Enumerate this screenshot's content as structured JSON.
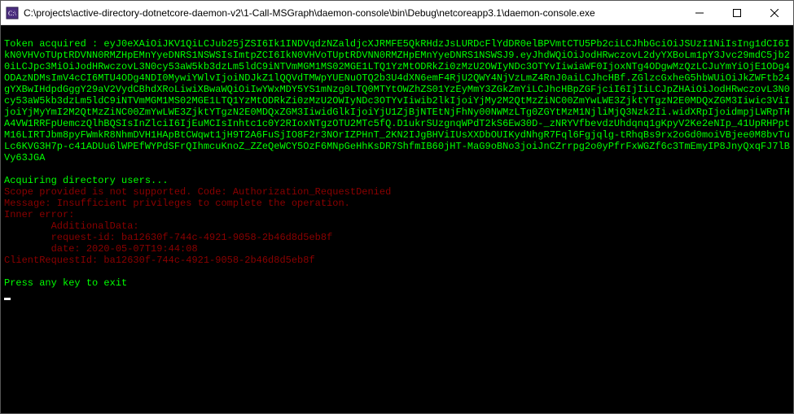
{
  "window": {
    "title": "C:\\projects\\active-directory-dotnetcore-daemon-v2\\1-Call-MSGraph\\daemon-console\\bin\\Debug\\netcoreapp3.1\\daemon-console.exe"
  },
  "console": {
    "token_prefix": "Token acquired : ",
    "token_value": "eyJ0eXAiOiJKV1QiLCJub25jZSI6Ik1INDVqdzNZaldjcXJRMFE5QkRHdzJsLURDcFlYdDR0elBPVmtCTU5Pb2ciLCJhbGciOiJSUzI1NiIsIng1dCI6IkN0VHVoTUptRDVNN0RMZHpEMnYyeDNRS1NSWSIsImtpZCI6IkN0VHVoTUptRDVNN0RMZHpEMnYyeDNRS1NSWSJ9.eyJhdWQiOiJodHRwczovL2dyYXBoLm1pY3Jvc29mdC5jb20iLCJpc3MiOiJodHRwczovL3N0cy53aW5kb3dzLm5ldC9iNTVmMGM1MS02MGE1LTQ1YzMtODRkZi0zMzU2OWIyNDc3OTYvIiwiaWF0IjoxNTg4ODgwMzQzLCJuYmYiOjE1ODg4ODAzNDMsImV4cCI6MTU4ODg4NDI0MywiYWlvIjoiNDJkZ1lQQVdTMWpYUENuOTQ2b3U4dXN6emF4RjU2QWY4NjVzLmZ4RnJ0aiLCJhcHBf.ZGlzcGxheG5hbWUiOiJkZWFtb24gYXBwIHdpdGggY29aV2VydCBhdXRoLiwiXBwaWQiOiIwYWxMDY5YS1mNzg0LTQ0MTYtOWZhZS01YzEyMmY3ZGkZmYiLCJhcHBpZGFjciI6IjIiLCJpZHAiOiJodHRwczovL3N0cy53aW5kb3dzLm5ldC9iNTVmMGM1MS02MGE1LTQ1YzMtODRkZi0zMzU2OWIyNDc3OTYvIiwib2lkIjoiYjMy2M2QtMzZiNC00ZmYwLWE3ZjktYTgzN2E0MDQxZGM3Iiwic3ViIjoiYjMyYmI2M2QtMzZiNC00ZmYwLWE3ZjktYTgzN2E0MDQxZGM3IiwidGlkIjoiYjU1ZjBjNTEtNjFhNy00NWMzLTg0ZGYtMzM1NjliMjQ3Nzk2Ii.widXRpIjoidmpjLWRpTHA4VW1RRFpUemczQlhBQSIsInZlciI6IjEuMCIsInhtc1c0Y2RIoxNTgzOTU2MTc5fQ.D1ukrSUzgnqWPdT2kS6Ew30D-_zNRYVfbevdzUhdqnq1gKpyV2Ke2eNIp_41UpRHPptM16LIRTJbm8pyFWmkR8NhmDVH1HApBtCWqwt1jH9T2A6FuSjIO8F2r3NOrIZPHnT_2KN2IJgBHViIUsXXDbOUIKydNhgR7Fql6Fgjqlg-tRhqBs9rx2oGd0moiVBjee0M8bvTuLc6KVG3H7p-c41ADUu6lWPEfWYPdSFrQIhmcuKnoZ_ZZeQeWCY5OzF6MNpGeHhKsDR7ShfmIB60jHT-MaG9oBNo3joiJnCZrrpg2o0yPfrFxWGZf6c3TmEmyIP8JnyQxqFJ7lBVy63JGA",
    "acquiring": "Acquiring directory users...",
    "err1": "Scope provided is not supported. Code: Authorization_RequestDenied",
    "err2": "Message: Insufficient privileges to complete the operation.",
    "err3": "Inner error:",
    "err4": "\tAdditionalData:",
    "err5": "\trequest-id: ba12630f-744c-4921-9058-2b46d8d5eb8f",
    "err6": "\tdate: 2020-05-07T19:44:08",
    "err7": "ClientRequestId: ba12630f-744c-4921-9058-2b46d8d5eb8f",
    "press": "Press any key to exit"
  }
}
